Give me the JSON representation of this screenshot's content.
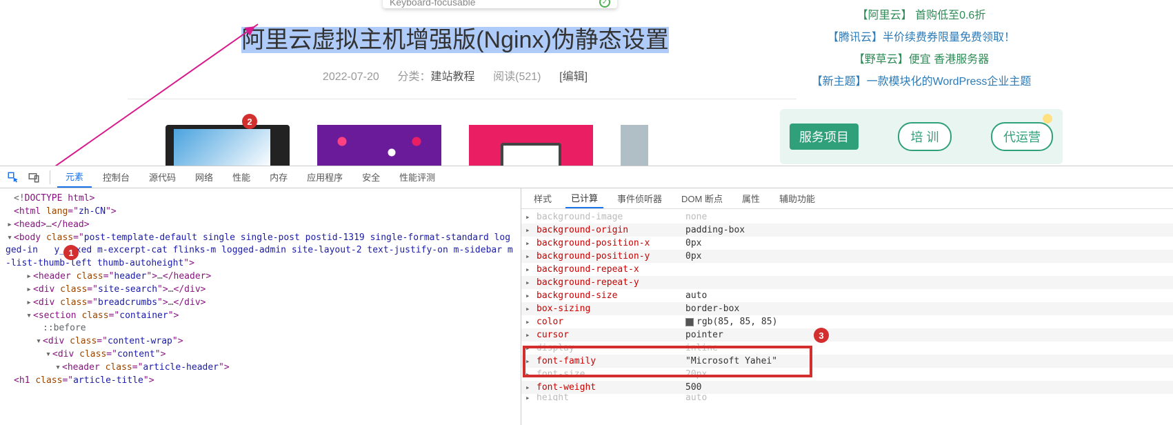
{
  "tooltip": {
    "text": "Keyboard-focusable"
  },
  "article": {
    "title": "阿里云虚拟主机增强版(Nginx)伪静态设置",
    "date": "2022-07-20",
    "category_label": "分类：",
    "category": "建站教程",
    "read_label": "阅读(521)",
    "edit": "[编辑]"
  },
  "side_links": [
    "【阿里云】 首购低至0.6折",
    "【腾讯云】半价续费券限量免费领取！",
    "【野草云】便宜 香港服务器",
    "【新主题】一款模块化的WordPress企业主题"
  ],
  "promo": {
    "title": "服务项目",
    "btn1": "培 训",
    "btn2": "代运营"
  },
  "badges": {
    "b1": "1",
    "b2": "2",
    "b3": "3"
  },
  "devtools_tabs": [
    "元素",
    "控制台",
    "源代码",
    "网络",
    "性能",
    "内存",
    "应用程序",
    "安全",
    "性能评测"
  ],
  "styles_tabs": [
    "样式",
    "已计算",
    "事件侦听器",
    "DOM 断点",
    "属性",
    "辅助功能"
  ],
  "dom": {
    "doctype": "<!DOCTYPE html>",
    "html_open": {
      "tag": "html",
      "attr": "lang",
      "val": "zh-CN"
    },
    "head": {
      "tag": "head"
    },
    "body": {
      "tag": "body",
      "attr": "class",
      "val": "post-template-default single single-post postid-1319 single-format-standard logged-in   y_fixed m-excerpt-cat flinks-m logged-admin site-layout-2 text-justify-on m-sidebar m-list-thumb-left thumb-autoheight"
    },
    "lines": [
      {
        "ind": 2,
        "tag": "header",
        "attr": "class",
        "val": "header",
        "closed": true
      },
      {
        "ind": 2,
        "tag": "div",
        "attr": "class",
        "val": "site-search",
        "closed": true
      },
      {
        "ind": 2,
        "tag": "div",
        "attr": "class",
        "val": "breadcrumbs",
        "closed": true
      },
      {
        "ind": 2,
        "tag": "section",
        "attr": "class",
        "val": "container",
        "closed": false
      },
      {
        "ind": 3,
        "pseudo": "::before"
      },
      {
        "ind": 3,
        "tag": "div",
        "attr": "class",
        "val": "content-wrap",
        "closed": false
      },
      {
        "ind": 4,
        "tag": "div",
        "attr": "class",
        "val": "content",
        "closed": false
      },
      {
        "ind": 5,
        "tag": "header",
        "attr": "class",
        "val": "article-header",
        "closed": false
      },
      {
        "ind": 6,
        "tag": "h1",
        "attr": "class",
        "val": "article-title",
        "closed": false,
        "notoggle": true
      }
    ]
  },
  "computed": [
    {
      "name": "background-image",
      "val": "none",
      "cut": true
    },
    {
      "name": "background-origin",
      "val": "padding-box"
    },
    {
      "name": "background-position-x",
      "val": "0px"
    },
    {
      "name": "background-position-y",
      "val": "0px"
    },
    {
      "name": "background-repeat-x",
      "val": ""
    },
    {
      "name": "background-repeat-y",
      "val": ""
    },
    {
      "name": "background-size",
      "val": "auto"
    },
    {
      "name": "box-sizing",
      "val": "border-box"
    },
    {
      "name": "color",
      "val": "rgb(85, 85, 85)",
      "swatch": true
    },
    {
      "name": "cursor",
      "val": "pointer"
    },
    {
      "name": "display",
      "val": "inline",
      "cut": true
    },
    {
      "name": "font-family",
      "val": "\"Microsoft Yahei\""
    },
    {
      "name": "font-size",
      "val": "20px",
      "cut": true
    },
    {
      "name": "font-weight",
      "val": "500"
    },
    {
      "name": "height",
      "val": "auto",
      "cut": true,
      "half": true
    }
  ]
}
